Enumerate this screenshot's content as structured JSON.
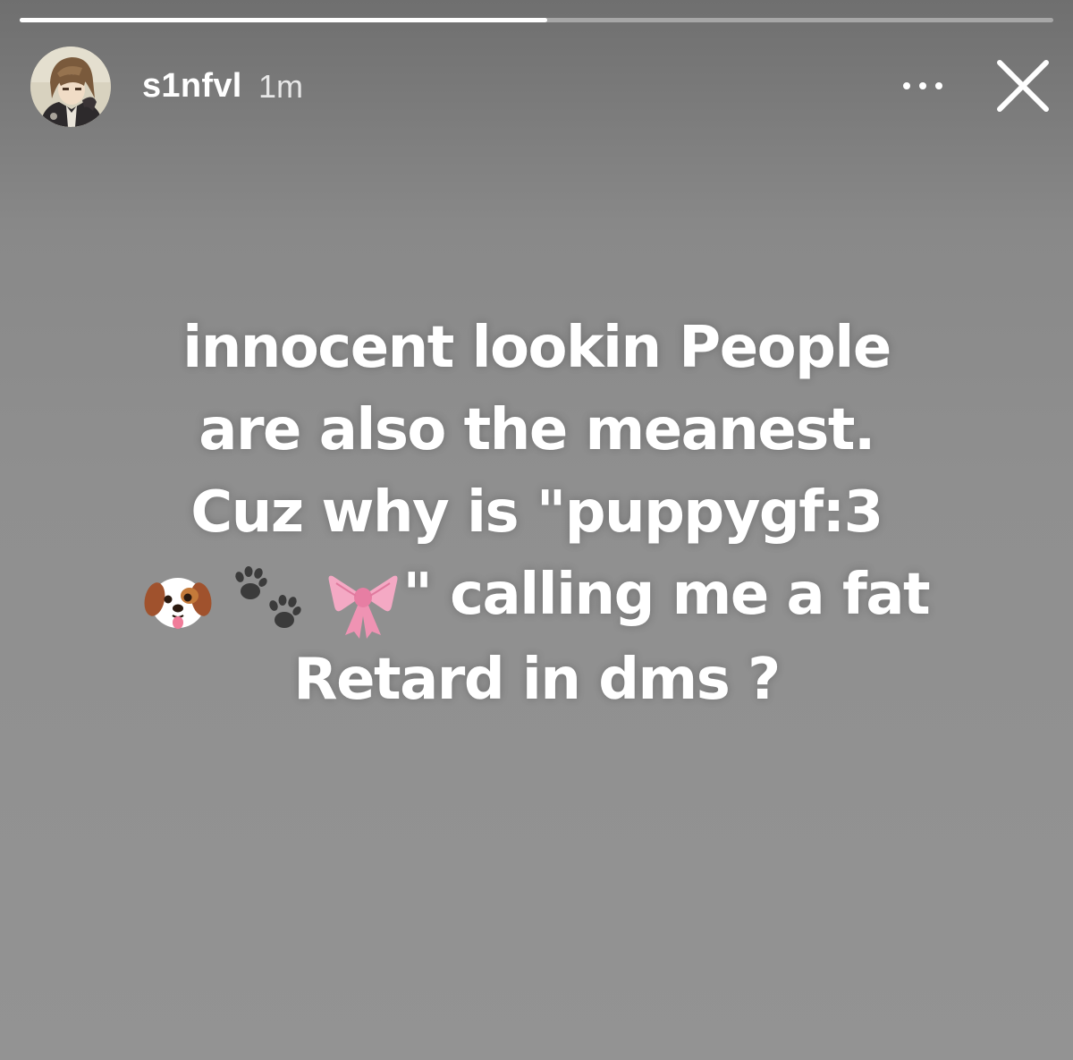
{
  "story": {
    "progress": 0.51,
    "header": {
      "username": "s1nfvl",
      "timestamp": "1m",
      "more_icon": "ellipsis-icon",
      "close_icon": "close-icon"
    },
    "text_lines": [
      "innocent lookin People",
      "are also the meanest.",
      "Cuz why is \"puppygf:3",
      "\" calling me a fat",
      "Retard in dms ?"
    ],
    "emojis": [
      "dog-face-emoji",
      "paw-prints-emoji",
      "ribbon-emoji"
    ],
    "colors": {
      "background": "#8f8f8f",
      "text": "#ffffff",
      "ribbon": "#f4a9c4"
    }
  }
}
